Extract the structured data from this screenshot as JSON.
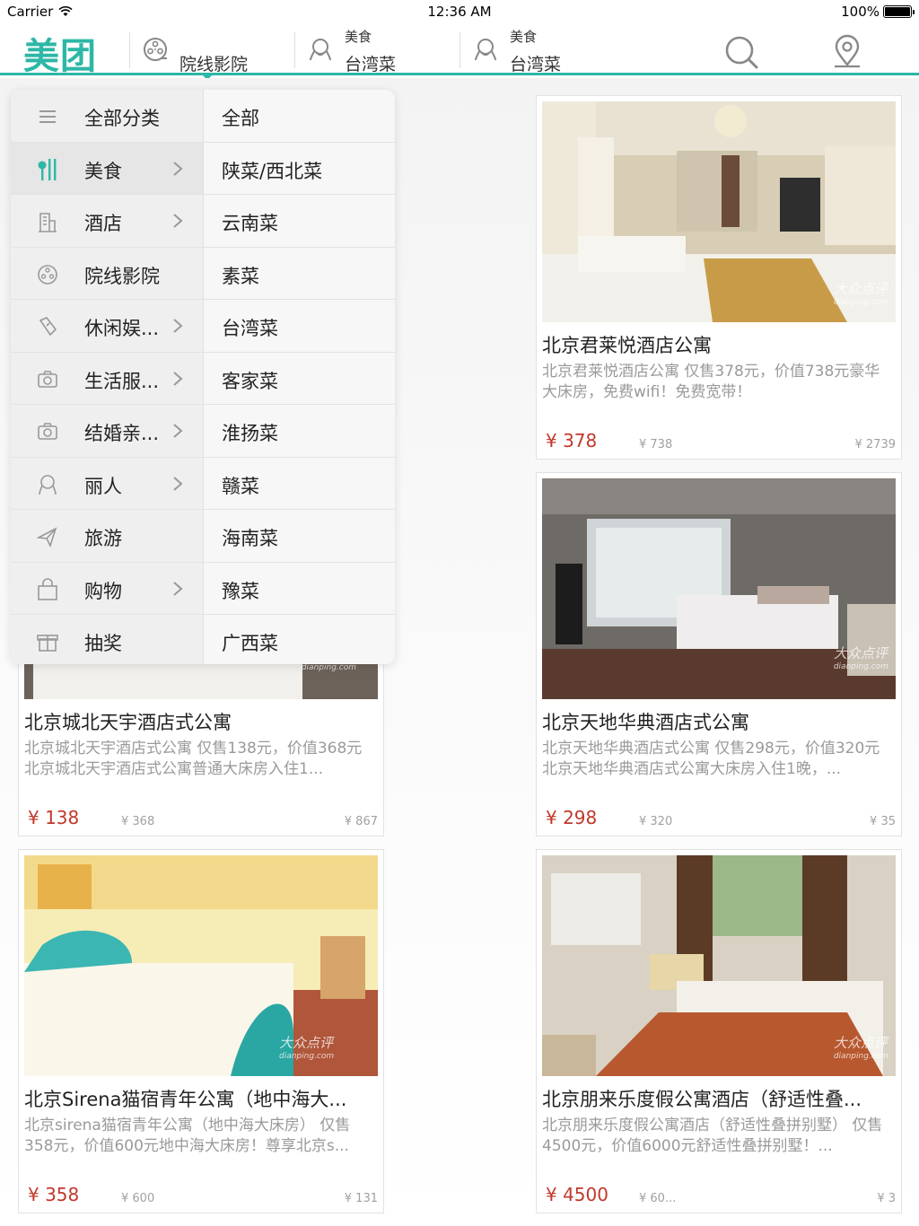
{
  "status_bar": {
    "carrier": "Carrier",
    "time": "12:36 AM",
    "battery": "100%"
  },
  "nav": {
    "logo": "美团",
    "items": [
      {
        "label": "院线影院"
      },
      {
        "top": "美食",
        "bottom": "台湾菜"
      },
      {
        "top": "美食",
        "bottom": "台湾菜"
      }
    ]
  },
  "menu": {
    "left": [
      {
        "label": "全部分类",
        "icon": "list-icon",
        "chevron": false
      },
      {
        "label": "美食",
        "icon": "fork-knife-icon",
        "chevron": true,
        "active": true
      },
      {
        "label": "酒店",
        "icon": "building-icon",
        "chevron": true
      },
      {
        "label": "院线影院",
        "icon": "film-reel-icon",
        "chevron": false
      },
      {
        "label": "休闲娱...",
        "icon": "brush-icon",
        "chevron": true
      },
      {
        "label": "生活服...",
        "icon": "camera-icon",
        "chevron": true
      },
      {
        "label": "结婚亲...",
        "icon": "camera-icon",
        "chevron": true
      },
      {
        "label": "丽人",
        "icon": "beauty-icon",
        "chevron": true
      },
      {
        "label": "旅游",
        "icon": "plane-icon",
        "chevron": false
      },
      {
        "label": "购物",
        "icon": "bag-icon",
        "chevron": true
      },
      {
        "label": "抽奖",
        "icon": "gift-icon",
        "chevron": false
      }
    ],
    "right": [
      "全部",
      "陕菜/西北菜",
      "云南菜",
      "素菜",
      "台湾菜",
      "客家菜",
      "淮扬菜",
      "赣菜",
      "海南菜",
      "豫菜",
      "广西菜"
    ]
  },
  "deals": [
    {
      "title": "北京君莱悦酒店公寓",
      "desc": "北京君莱悦酒店公寓 仅售378元，价值738元豪华大床房，免费wifi！免费宽带！",
      "price": "¥ 378",
      "orig": "¥ 738",
      "sold": "¥ 2739"
    },
    {
      "title": "北京城北天宇酒店式公寓",
      "desc": "北京城北天宇酒店式公寓 仅售138元，价值368元北京城北天宇酒店式公寓普通大床房入住1...",
      "price": "¥ 138",
      "orig": "¥ 368",
      "sold": "¥ 867"
    },
    {
      "title": "北京天地华典酒店式公寓",
      "desc": "北京天地华典酒店式公寓 仅售298元，价值320元北京天地华典酒店式公寓大床房入住1晚，...",
      "price": "¥ 298",
      "orig": "¥ 320",
      "sold": "¥ 35"
    },
    {
      "title": "北京Sirena猫宿青年公寓（地中海大...",
      "desc": "北京sirena猫宿青年公寓（地中海大床房） 仅售358元，价值600元地中海大床房！尊享北京s...",
      "price": "¥ 358",
      "orig": "¥ 600",
      "sold": "¥ 131"
    },
    {
      "title": "北京朋来乐度假公寓酒店（舒适性叠...",
      "desc": "北京朋来乐度假公寓酒店（舒适性叠拼别墅） 仅售4500元，价值6000元舒适性叠拼别墅！...",
      "price": "¥ 4500",
      "orig": "¥ 60...",
      "sold": "¥ 3"
    }
  ],
  "watermark": {
    "main": "大众点评",
    "sub": "dianping.com"
  },
  "colors": {
    "accent": "#2db7a6",
    "price": "#c0392b"
  }
}
